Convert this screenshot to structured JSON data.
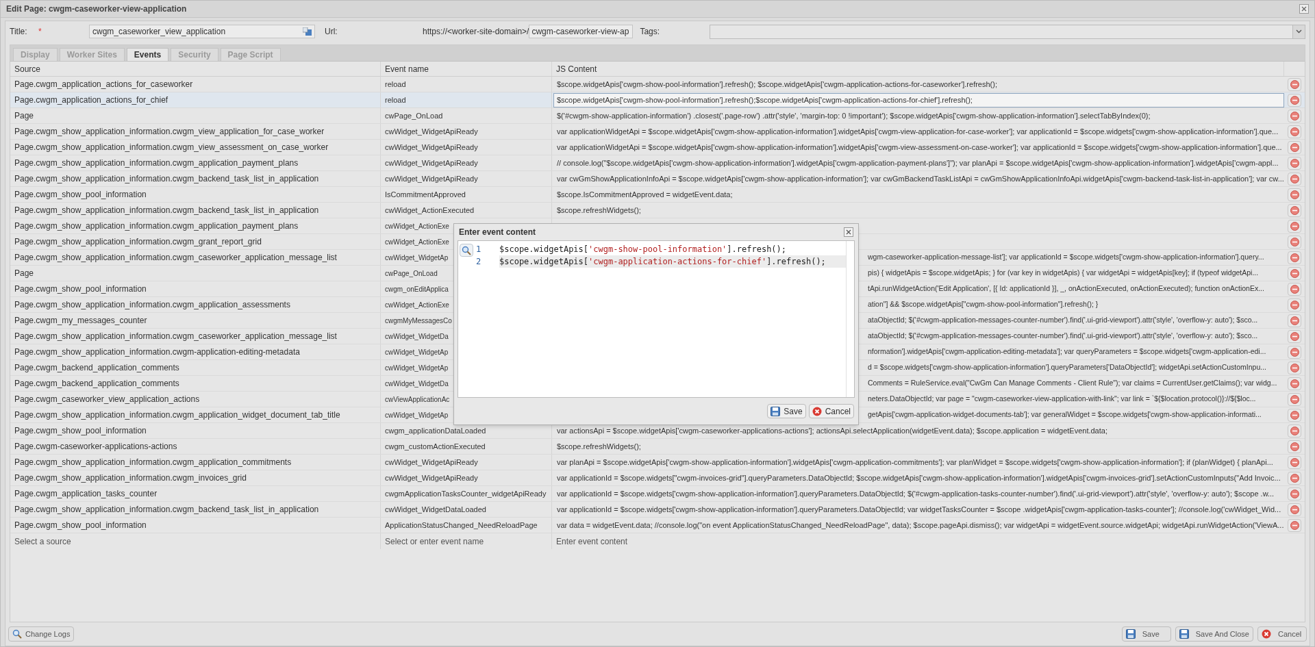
{
  "window": {
    "title": "Edit Page: cwgm-caseworker-view-application"
  },
  "form": {
    "title_label": "Title:",
    "required_mark": "*",
    "title_value": "cwgm_caseworker_view_application",
    "url_label": "Url:",
    "url_prefix": "https://<worker-site-domain>/",
    "url_value": "cwgm-caseworker-view-ap",
    "tags_label": "Tags:"
  },
  "tabs": [
    {
      "label": "Display",
      "selected": false
    },
    {
      "label": "Worker Sites",
      "selected": false
    },
    {
      "label": "Events",
      "selected": true
    },
    {
      "label": "Security",
      "selected": false
    },
    {
      "label": "Page Script",
      "selected": false
    }
  ],
  "table": {
    "columns": [
      "Source",
      "Event name",
      "JS Content"
    ],
    "rows": [
      {
        "kind": "full",
        "selected": false,
        "source": "Page.cwgm_application_actions_for_caseworker",
        "event": "reload",
        "js": "$scope.widgetApis['cwgm-show-pool-information'].refresh(); $scope.widgetApis['cwgm-application-actions-for-caseworker'].refresh();"
      },
      {
        "kind": "full",
        "selected": true,
        "source": "Page.cwgm_application_actions_for_chief",
        "event": "reload",
        "js": "$scope.widgetApis['cwgm-show-pool-information'].refresh();$scope.widgetApis['cwgm-application-actions-for-chief'].refresh();"
      },
      {
        "kind": "full",
        "selected": false,
        "source": "Page",
        "event": "cwPage_OnLoad",
        "js": "$('#cwgm-show-application-information') .closest('.page-row') .attr('style', 'margin-top: 0 !important'); $scope.widgetApis['cwgm-show-application-information'].selectTabByIndex(0);"
      },
      {
        "kind": "full",
        "selected": false,
        "source": "Page.cwgm_show_application_information.cwgm_view_application_for_case_worker",
        "event": "cwWidget_WidgetApiReady",
        "js": "var applicationWidgetApi = $scope.widgetApis['cwgm-show-application-information'].widgetApis['cwgm-view-application-for-case-worker']; var applicationId = $scope.widgets['cwgm-show-application-information'].que..."
      },
      {
        "kind": "full",
        "selected": false,
        "source": "Page.cwgm_show_application_information.cwgm_view_assessment_on_case_worker",
        "event": "cwWidget_WidgetApiReady",
        "js": "var applicationWidgetApi = $scope.widgetApis['cwgm-show-application-information'].widgetApis['cwgm-view-assessment-on-case-worker']; var applicationId = $scope.widgets['cwgm-show-application-information'].que..."
      },
      {
        "kind": "full",
        "selected": false,
        "source": "Page.cwgm_show_application_information.cwgm_application_payment_plans",
        "event": "cwWidget_WidgetApiReady",
        "js": "// console.log(\"$scope.widgetApis['cwgm-show-application-information'].widgetApis['cwgm-application-payment-plans']\"); var planApi = $scope.widgetApis['cwgm-show-application-information'].widgetApis['cwgm-appl..."
      },
      {
        "kind": "full",
        "selected": false,
        "source": "Page.cwgm_show_application_information.cwgm_backend_task_list_in_application",
        "event": "cwWidget_WidgetApiReady",
        "js": "var cwGmShowApplicationInfoApi = $scope.widgetApis['cwgm-show-application-information']; var cwGmBackendTaskListApi = cwGmShowApplicationInfoApi.widgetApis['cwgm-backend-task-list-in-application']; var cw..."
      },
      {
        "kind": "full",
        "selected": false,
        "source": "Page.cwgm_show_pool_information",
        "event": "IsCommitmentApproved",
        "js": "$scope.IsCommitmentApproved = widgetEvent.data;"
      },
      {
        "kind": "full",
        "selected": false,
        "source": "Page.cwgm_show_application_information.cwgm_backend_task_list_in_application",
        "event": "cwWidget_ActionExecuted",
        "js": "$scope.refreshWidgets();"
      },
      {
        "kind": "covered",
        "source": "Page.cwgm_show_application_information.cwgm_application_payment_plans",
        "event": "cwWidget_ActionExe"
      },
      {
        "kind": "covered",
        "source": "Page.cwgm_show_application_information.cwgm_grant_report_grid",
        "event": "cwWidget_ActionExe"
      },
      {
        "kind": "covered",
        "selected": false,
        "source": "Page.cwgm_show_application_information.cwgm_caseworker_application_message_list",
        "event": "cwWidget_WidgetAp",
        "js": "wgm-caseworker-application-message-list']; var applicationId = $scope.widgets['cwgm-show-application-information'].query..."
      },
      {
        "kind": "covered",
        "selected": false,
        "source": "Page",
        "event": "cwPage_OnLoad",
        "js": "pis) { widgetApis = $scope.widgetApis; } for (var key in widgetApis) { var widgetApi = widgetApis[key]; if (typeof widgetApi..."
      },
      {
        "kind": "covered",
        "selected": false,
        "source": "Page.cwgm_show_pool_information",
        "event": "cwgm_onEditApplica",
        "js": "tApi.runWidgetAction('Edit Application', [{ Id: applicationId }], _, onActionExecuted, onActionExecuted); function onActionEx..."
      },
      {
        "kind": "covered",
        "selected": false,
        "source": "Page.cwgm_show_application_information.cwgm_application_assessments",
        "event": "cwWidget_ActionExe",
        "js": "ation\"] && $scope.widgetApis[\"cwgm-show-pool-information\"].refresh(); }"
      },
      {
        "kind": "covered",
        "selected": false,
        "source": "Page.cwgm_my_messages_counter",
        "event": "cwgmMyMessagesCo",
        "js": "ataObjectId; $('#cwgm-application-messages-counter-number').find('.ui-grid-viewport').attr('style', 'overflow-y: auto'); $sco..."
      },
      {
        "kind": "covered",
        "selected": false,
        "source": "Page.cwgm_show_application_information.cwgm_caseworker_application_message_list",
        "event": "cwWidget_WidgetDa",
        "js": "ataObjectId; $('#cwgm-application-messages-counter-number').find('.ui-grid-viewport').attr('style', 'overflow-y: auto'); $sco..."
      },
      {
        "kind": "covered",
        "selected": false,
        "source": "Page.cwgm_show_application_information.cwgm-application-editing-metadata",
        "event": "cwWidget_WidgetAp",
        "js": "nformation'].widgetApis['cwgm-application-editing-metadata']; var queryParameters = $scope.widgets['cwgm-application-edi..."
      },
      {
        "kind": "covered",
        "selected": false,
        "source": "Page.cwgm_backend_application_comments",
        "event": "cwWidget_WidgetAp",
        "js": "d = $scope.widgets['cwgm-show-application-information'].queryParameters['DataObjectId']; widgetApi.setActionCustomInpu..."
      },
      {
        "kind": "covered",
        "selected": false,
        "source": "Page.cwgm_backend_application_comments",
        "event": "cwWidget_WidgetDa",
        "js": "Comments = RuleService.eval(\"CwGm Can Manage Comments - Client Rule\"); var claims = CurrentUser.getClaims(); var widg..."
      },
      {
        "kind": "covered",
        "selected": false,
        "source": "Page.cwgm_caseworker_view_application_actions",
        "event": "cwViewApplicationAc",
        "js": "neters.DataObjectId; var page = \"cwgm-caseworker-view-application-with-link\"; var link = `${$location.protocol()}://${$loc..."
      },
      {
        "kind": "covered",
        "selected": false,
        "source": "Page.cwgm_show_application_information.cwgm_application_widget_document_tab_title",
        "event": "cwWidget_WidgetAp",
        "js": "getApis['cwgm-application-widget-documents-tab']; var generalWidget = $scope.widgets['cwgm-show-application-informati..."
      },
      {
        "kind": "full",
        "selected": false,
        "source": "Page.cwgm_show_pool_information",
        "event": "cwgm_applicationDataLoaded",
        "js": "var actionsApi = $scope.widgetApis['cwgm-caseworker-applications-actions']; actionsApi.selectApplication(widgetEvent.data); $scope.application = widgetEvent.data;"
      },
      {
        "kind": "full",
        "selected": false,
        "source": "Page.cwgm-caseworker-applications-actions",
        "event": "cwgm_customActionExecuted",
        "js": "$scope.refreshWidgets();"
      },
      {
        "kind": "full",
        "selected": false,
        "source": "Page.cwgm_show_application_information.cwgm_application_commitments",
        "event": "cwWidget_WidgetApiReady",
        "js": "var planApi = $scope.widgetApis['cwgm-show-application-information'].widgetApis['cwgm-application-commitments']; var planWidget = $scope.widgets['cwgm-show-application-information']; if (planWidget) { planApi..."
      },
      {
        "kind": "full",
        "selected": false,
        "source": "Page.cwgm_show_application_information.cwgm_invoices_grid",
        "event": "cwWidget_WidgetApiReady",
        "js": "var applicationId = $scope.widgets[\"cwgm-invoices-grid\"].queryParameters.DataObjectId; $scope.widgetApis['cwgm-show-application-information'].widgetApis['cwgm-invoices-grid'].setActionCustomInputs(\"Add Invoic..."
      },
      {
        "kind": "full",
        "selected": false,
        "source": "Page.cwgm_application_tasks_counter",
        "event": "cwgmApplicationTasksCounter_widgetApiReady",
        "js": "var applicationId = $scope.widgets['cwgm-show-application-information'].queryParameters.DataObjectId; $('#cwgm-application-tasks-counter-number').find('.ui-grid-viewport').attr('style', 'overflow-y: auto'); $scope .w..."
      },
      {
        "kind": "full",
        "selected": false,
        "source": "Page.cwgm_show_application_information.cwgm_backend_task_list_in_application",
        "event": "cwWidget_WidgetDataLoaded",
        "js": "var applicationId = $scope.widgets['cwgm-show-application-information'].queryParameters.DataObjectId; var widgetTasksCounter = $scope .widgetApis['cwgm-application-tasks-counter']; //console.log('cwWidget_Wid..."
      },
      {
        "kind": "full",
        "selected": false,
        "source": "Page.cwgm_show_pool_information",
        "event": "ApplicationStatusChanged_NeedReloadPage",
        "js": "var data = widgetEvent.data; //console.log(\"on event ApplicationStatusChanged_NeedReloadPage\", data); $scope.pageApi.dismiss(); var widgetApi = widgetEvent.source.widgetApi; widgetApi.runWidgetAction('ViewA..."
      }
    ],
    "new_row": {
      "source_placeholder": "Select a source",
      "event_placeholder": "Select or enter event name",
      "js_placeholder": "Enter event content"
    }
  },
  "dialog": {
    "title": "Enter event content",
    "lines": [
      {
        "number": "1",
        "current": false,
        "tokens": [
          {
            "kind": "plain",
            "text": "$scope.widgetApis["
          },
          {
            "kind": "string",
            "text": "'cwgm-show-pool-information'"
          },
          {
            "kind": "plain",
            "text": "].refresh();"
          }
        ]
      },
      {
        "number": "2",
        "current": true,
        "tokens": [
          {
            "kind": "plain",
            "text": "$scope.widgetApis["
          },
          {
            "kind": "string",
            "text": "'cwgm-application-actions-for-chief'"
          },
          {
            "kind": "plain",
            "text": "].refresh();"
          }
        ]
      }
    ],
    "buttons": [
      {
        "kind": "save",
        "label": "Save"
      },
      {
        "kind": "cancel",
        "label": "Cancel"
      }
    ]
  },
  "footer": {
    "left": [
      {
        "kind": "search",
        "label": "Change Logs"
      }
    ],
    "right": [
      {
        "kind": "save",
        "label": "Save"
      },
      {
        "kind": "save",
        "label": "Save And Close"
      },
      {
        "kind": "cancel",
        "label": "Cancel"
      }
    ]
  }
}
